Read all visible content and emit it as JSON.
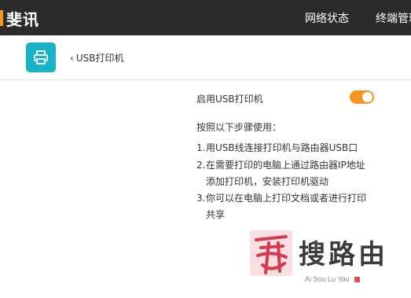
{
  "topbar": {
    "brand": "斐讯",
    "nav": [
      "网络状态",
      "终端管理"
    ]
  },
  "page": {
    "app_icon": "printer-icon",
    "back_label": "USB打印机"
  },
  "usb_printer": {
    "toggle_label": "启用USB打印机",
    "enabled": true,
    "steps_title": "按照以下步骤使用：",
    "steps": [
      {
        "num": "1.",
        "lines": [
          "用USB线连接打印机与路由器USB口"
        ]
      },
      {
        "num": "2.",
        "lines": [
          "在需要打印的电脑上通过路由器IP地址",
          "添加打印机，安装打印机驱动"
        ]
      },
      {
        "num": "3.",
        "lines": [
          "你可以在电脑上打印文档或者进行打印",
          "共享"
        ]
      }
    ]
  },
  "watermark": {
    "chars": "搜路由",
    "seal_char": "爱",
    "sub": "Ai Sou Lu You"
  },
  "colors": {
    "accent": "#f5951f",
    "icon_bg": "#17b4c7",
    "topbar_bg": "#2b2b2b"
  }
}
